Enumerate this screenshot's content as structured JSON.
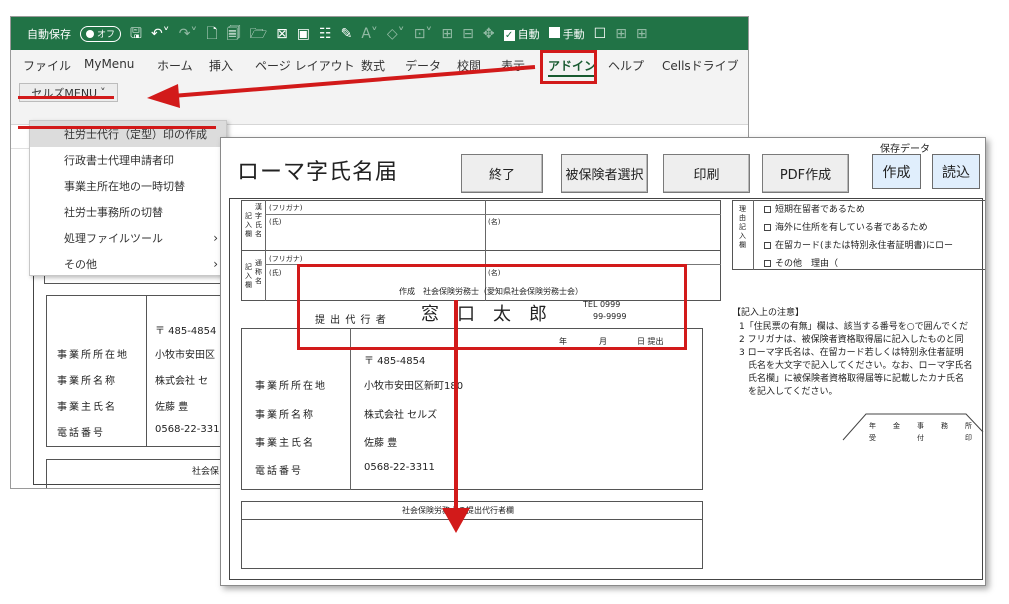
{
  "excel": {
    "qat": {
      "autosave_label": "自動保存",
      "autosave_state": "オフ",
      "auto_check_label": "自動",
      "manual_label": "手動"
    },
    "menu": [
      "ファイル",
      "MyMenu",
      "ホーム",
      "挿入",
      "ページ レイアウト",
      "数式",
      "データ",
      "校閲",
      "表示",
      "アドイン",
      "ヘルプ",
      "Cellsドライブ"
    ],
    "active_tab": "アドイン",
    "cells_menu_label": "セルズMENU",
    "dropdown_items": [
      {
        "label": "社労士代行（定型）印の作成",
        "submenu": false
      },
      {
        "label": "行政書士代理申請者印",
        "submenu": false
      },
      {
        "label": "事業主所在地の一時切替",
        "submenu": false
      },
      {
        "label": "社労士事務所の切替",
        "submenu": false
      },
      {
        "label": "処理ファイルツール",
        "submenu": true
      },
      {
        "label": "その他",
        "submenu": true
      }
    ],
    "left_sheet": {
      "name_label": "名",
      "postal": "〒 485-4854",
      "fields": [
        {
          "label": "事業所所在地",
          "value": "小牧市安田区"
        },
        {
          "label": "事業所名称",
          "value": "株式会社 セ"
        },
        {
          "label": "事業主氏名",
          "value": "佐藤 豊"
        },
        {
          "label": "電話番号",
          "value": "0568-22-331"
        }
      ],
      "sr_fragment": "社会保"
    }
  },
  "form": {
    "title": "ローマ字氏名届",
    "buttons": {
      "end": "終了",
      "select_insured": "被保険者選択",
      "print": "印刷",
      "pdf": "PDF作成"
    },
    "save_data": {
      "label": "保存データ",
      "create": "作成",
      "load": "読込"
    },
    "name_block": {
      "vertical_label_1": [
        "記",
        "入",
        "欄"
      ],
      "vertical_label_2": [
        "漢",
        "字",
        "氏",
        "名"
      ],
      "vertical_label_3": [
        "記",
        "入",
        "欄"
      ],
      "vertical_label_4": [
        "通",
        "称",
        "名"
      ],
      "furigana": "(フリガナ)",
      "surname": "(氏)",
      "given": "(名)"
    },
    "reason_block": {
      "vertical_label": [
        "理",
        "由",
        "記",
        "入",
        "欄"
      ],
      "items": [
        "短期在留者であるため",
        "海外に住所を有している者であるため",
        "在留カード(または特別永住者証明書)にロー",
        "その他　理由（"
      ]
    },
    "stamp": {
      "created_by": "作成　社会保険労務士（愛知県社会保険労務士会）",
      "agent_label": "提 出 代 行 者",
      "agent_name": "窓　口　太　郎",
      "tel_label": "TEL 0999",
      "tel_number": "99-9999"
    },
    "date_line": {
      "year": "年",
      "month": "月",
      "day": "日 提出"
    },
    "employer": {
      "postal": "〒 485-4854",
      "fields": [
        {
          "label": "事業所所在地",
          "value": "小牧市安田区新町180"
        },
        {
          "label": "事業所名称",
          "value": "株式会社 セルズ"
        },
        {
          "label": "事業主氏名",
          "value": "佐藤 豊"
        },
        {
          "label": "電話番号",
          "value": "0568-22-3311"
        }
      ]
    },
    "agent_section_title": "社会保険労務士の提出代行者欄",
    "notes": {
      "title": "【記入上の注意】",
      "lines": [
        "1「住民票の有無」欄は、該当する番号を○で囲んでくだ",
        "2 フリガナは、被保険者資格取得届に記入したものと同",
        "3 ローマ字氏名は、在留カード若しくは特別永住者証明",
        "　氏名を大文字で記入してください。なお、ローマ字氏名",
        "　氏名欄」に被保険者資格取得届等に記載したカナ氏名",
        "　を記入してください。"
      ]
    },
    "pension_office": {
      "top": [
        "年",
        "金",
        "事",
        "務",
        "所"
      ],
      "bottom": [
        "受",
        "付",
        "印"
      ]
    }
  },
  "colors": {
    "excel_green": "#217346",
    "annotation_red": "#d21a1a",
    "save_button_bg": "#e0eefc"
  }
}
